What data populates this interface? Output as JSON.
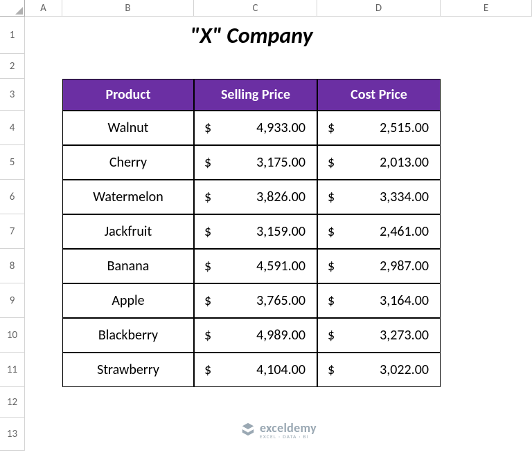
{
  "columns": [
    "A",
    "B",
    "C",
    "D",
    "E"
  ],
  "rows": [
    "1",
    "2",
    "3",
    "4",
    "5",
    "6",
    "7",
    "8",
    "9",
    "10",
    "11",
    "12",
    "13"
  ],
  "title": "\"X\" Company",
  "table": {
    "headers": [
      "Product",
      "Selling Price",
      "Cost Price"
    ],
    "data": [
      {
        "product": "Walnut",
        "selling": "4,933.00",
        "cost": "2,515.00"
      },
      {
        "product": "Cherry",
        "selling": "3,175.00",
        "cost": "2,013.00"
      },
      {
        "product": "Watermelon",
        "selling": "3,826.00",
        "cost": "3,334.00"
      },
      {
        "product": "Jackfruit",
        "selling": "3,159.00",
        "cost": "2,461.00"
      },
      {
        "product": "Banana",
        "selling": "4,591.00",
        "cost": "2,987.00"
      },
      {
        "product": "Apple",
        "selling": "3,765.00",
        "cost": "3,164.00"
      },
      {
        "product": "Blackberry",
        "selling": "4,989.00",
        "cost": "3,273.00"
      },
      {
        "product": "Strawberry",
        "selling": "4,104.00",
        "cost": "3,022.00"
      }
    ],
    "currency_symbol": "$"
  },
  "watermark": {
    "main": "exceldemy",
    "sub": "EXCEL · DATA · BI"
  },
  "chart_data": {
    "type": "table",
    "title": "\"X\" Company",
    "columns": [
      "Product",
      "Selling Price",
      "Cost Price"
    ],
    "rows": [
      [
        "Walnut",
        4933.0,
        2515.0
      ],
      [
        "Cherry",
        3175.0,
        2013.0
      ],
      [
        "Watermelon",
        3826.0,
        3334.0
      ],
      [
        "Jackfruit",
        3159.0,
        2461.0
      ],
      [
        "Banana",
        4591.0,
        2987.0
      ],
      [
        "Apple",
        3765.0,
        3164.0
      ],
      [
        "Blackberry",
        4989.0,
        3273.0
      ],
      [
        "Strawberry",
        4104.0,
        3022.0
      ]
    ]
  }
}
